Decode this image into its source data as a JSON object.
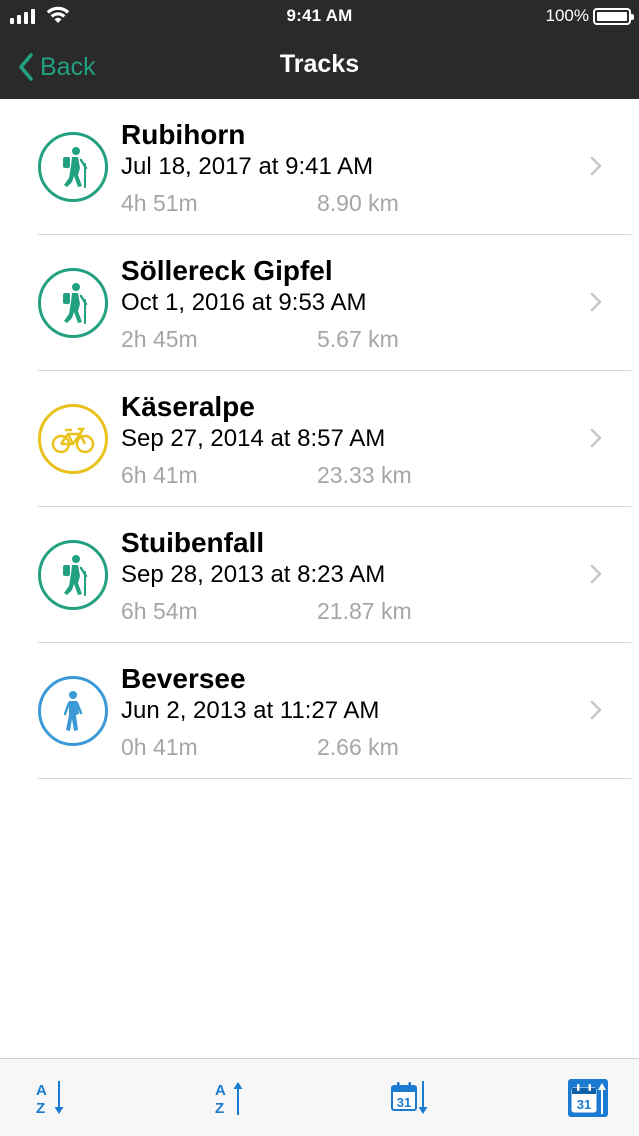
{
  "status": {
    "time": "9:41 AM",
    "battery": "100%"
  },
  "nav": {
    "back_label": "Back",
    "title": "Tracks"
  },
  "colors": {
    "accent": "#22a180",
    "hiking": "#22a180",
    "biking": "#e9c21d",
    "walking": "#3b9ad6",
    "toolbar_icon": "#1a7bd1"
  },
  "tracks": [
    {
      "name": "Rubihorn",
      "date": "Jul 18, 2017 at 9:41 AM",
      "duration": "4h 51m",
      "distance": "8.90 km",
      "activity": "hiking-icon"
    },
    {
      "name": "Söllereck Gipfel",
      "date": "Oct 1, 2016 at 9:53 AM",
      "duration": "2h 45m",
      "distance": "5.67 km",
      "activity": "hiking-icon"
    },
    {
      "name": "Käseralpe",
      "date": "Sep 27, 2014 at 8:57 AM",
      "duration": "6h 41m",
      "distance": "23.33 km",
      "activity": "bike-icon"
    },
    {
      "name": "Stuibenfall",
      "date": "Sep 28, 2013 at 8:23 AM",
      "duration": "6h 54m",
      "distance": "21.87 km",
      "activity": "hiking-icon"
    },
    {
      "name": "Beversee",
      "date": "Jun 2, 2013 at 11:27 AM",
      "duration": "0h 41m",
      "distance": "2.66 km",
      "activity": "walking-icon"
    }
  ],
  "toolbar": {
    "sort_az": {
      "letters_top": "A",
      "letters_bottom": "Z"
    },
    "sort_za": {
      "letters_top": "A",
      "letters_bottom": "Z"
    },
    "sort_date_desc": {
      "day": "31"
    },
    "sort_date_asc": {
      "day": "31"
    }
  }
}
